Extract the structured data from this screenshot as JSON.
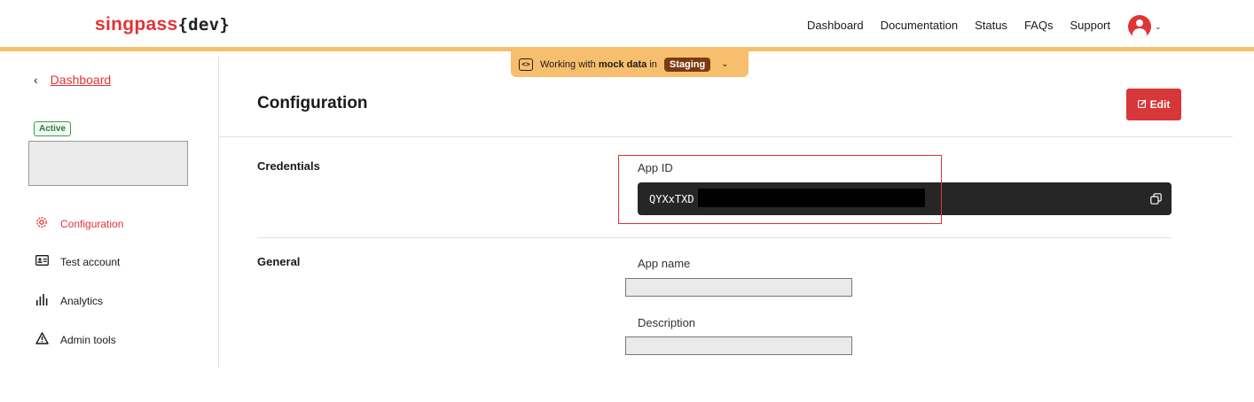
{
  "header": {
    "logo_brand": "singpass",
    "logo_suffix": "{dev}",
    "nav": [
      "Dashboard",
      "Documentation",
      "Status",
      "FAQs",
      "Support"
    ],
    "avatar_icon": "user-avatar-icon"
  },
  "environment_banner": {
    "prefix": "Working with",
    "emphasis": "mock data",
    "mid": "in",
    "environment": "Staging"
  },
  "sidebar": {
    "back_label": "Dashboard",
    "status_badge": "Active",
    "items": [
      {
        "label": "Configuration",
        "icon": "gear-icon",
        "active": true
      },
      {
        "label": "Test account",
        "icon": "id-card-icon",
        "active": false
      },
      {
        "label": "Analytics",
        "icon": "bar-chart-icon",
        "active": false
      },
      {
        "label": "Admin tools",
        "icon": "warning-icon",
        "active": false
      }
    ]
  },
  "main": {
    "title": "Configuration",
    "edit_label": "Edit",
    "sections": {
      "credentials": {
        "label": "Credentials",
        "app_id_label": "App ID",
        "app_id_value": "QYXxTXD"
      },
      "general": {
        "label": "General",
        "app_name_label": "App name",
        "description_label": "Description"
      }
    }
  },
  "colors": {
    "brand_red": "#e03436",
    "banner_orange": "#f7bf6d",
    "env_pill": "#7a3b12",
    "active_green": "#3e9b50"
  }
}
